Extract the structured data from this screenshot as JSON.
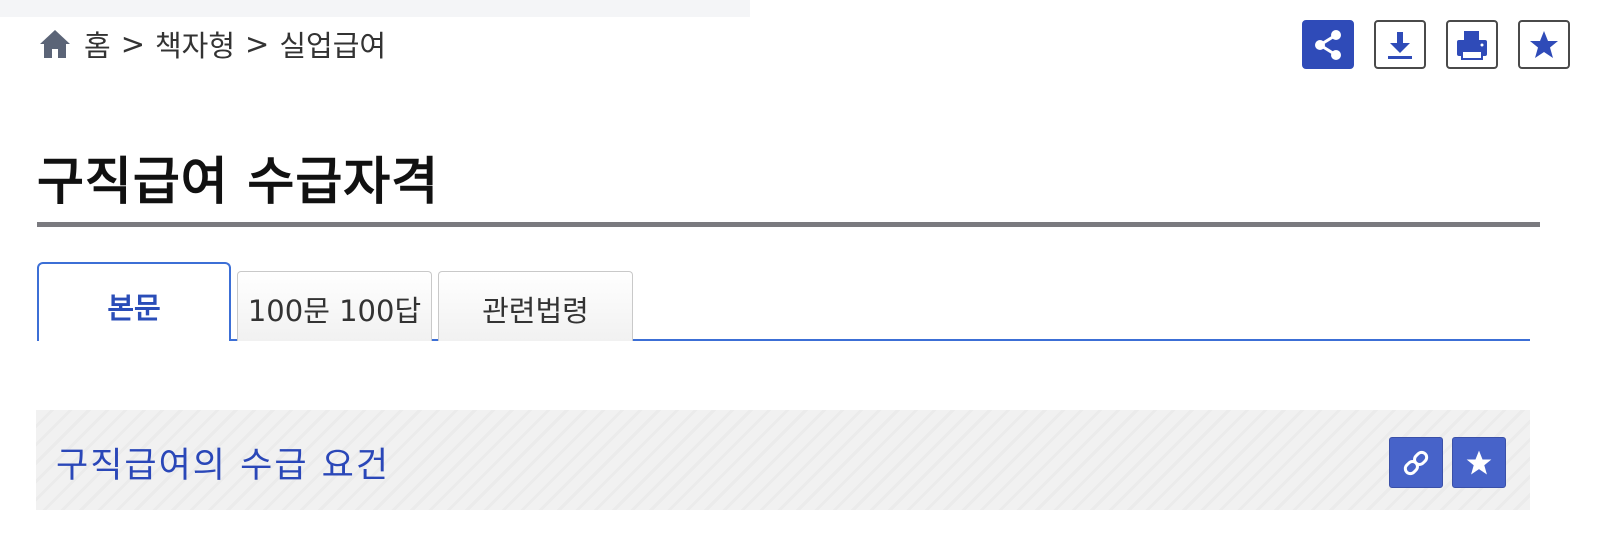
{
  "breadcrumb": {
    "home_icon": "home-icon",
    "items": [
      "홈",
      "책자형",
      "실업급여"
    ],
    "separator": ">"
  },
  "toolbar": {
    "buttons": [
      {
        "icon": "share-icon",
        "style": "primary"
      },
      {
        "icon": "download-icon",
        "style": "outline"
      },
      {
        "icon": "print-icon",
        "style": "outline"
      },
      {
        "icon": "star-icon",
        "style": "outline"
      }
    ]
  },
  "page": {
    "title": "구직급여 수급자격"
  },
  "tabs": [
    {
      "label": "본문",
      "active": true
    },
    {
      "label": "100문 100답",
      "active": false
    },
    {
      "label": "관련법령",
      "active": false
    }
  ],
  "section": {
    "title": "구직급여의 수급 요건",
    "actions": [
      {
        "icon": "link-icon"
      },
      {
        "icon": "star-icon"
      }
    ]
  },
  "colors": {
    "accent": "#2f4bb8",
    "tab_border": "#3c6fd6",
    "section_title": "#2a47b8",
    "section_button": "#4763c9"
  }
}
